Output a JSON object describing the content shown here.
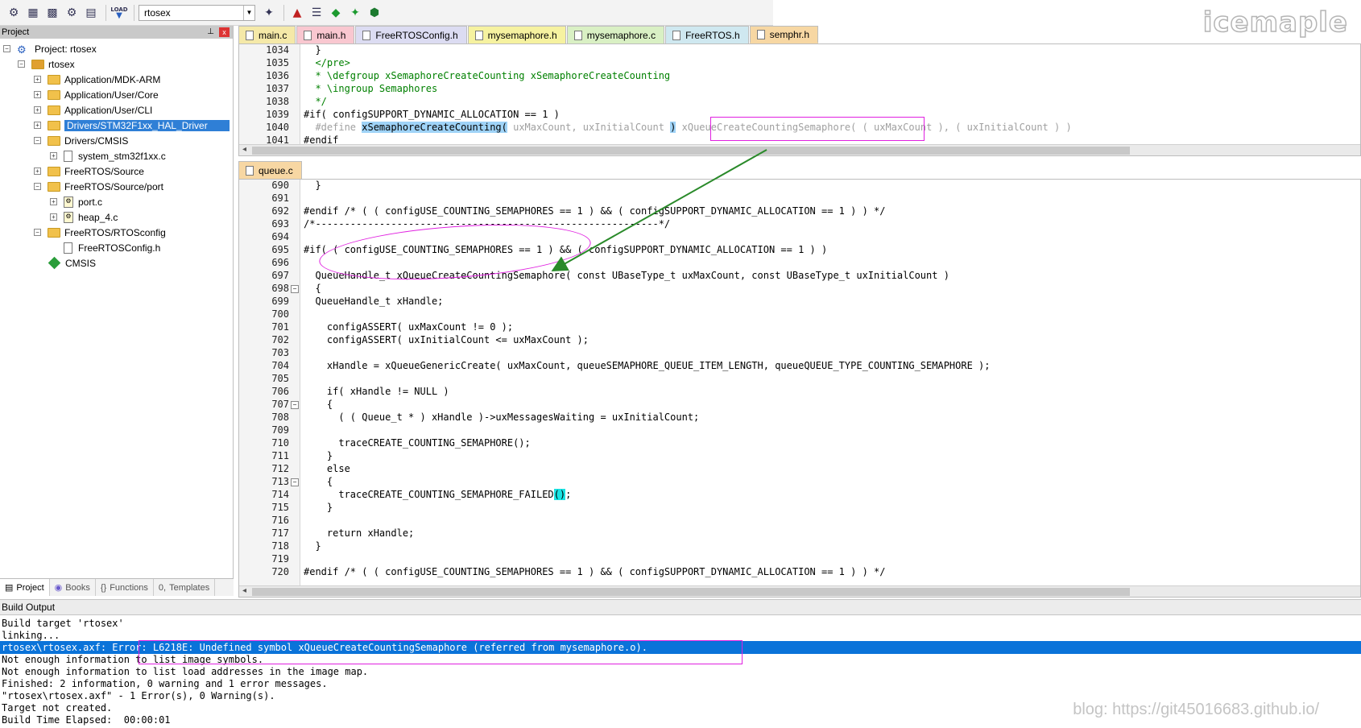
{
  "toolbar": {
    "target_value": "rtosex",
    "load_label": "LOAD",
    "icons": [
      "translate-icon",
      "build-icon",
      "rebuild-icon",
      "batch-build-icon",
      "stop-build-icon",
      "download-icon",
      "target-options-icon",
      "manage-components-icon",
      "manage-books-icon",
      "pack-installer-icon",
      "run-environment-icon",
      "software-packs-icon"
    ]
  },
  "watermark_top": "icemaple",
  "project": {
    "title": "Project",
    "pin": "⊥",
    "close": "x",
    "root": "Project: rtosex",
    "target": "rtosex",
    "groups": [
      {
        "label": "Application/MDK-ARM",
        "expander": "+"
      },
      {
        "label": "Application/User/Core",
        "expander": "+"
      },
      {
        "label": "Application/User/CLI",
        "expander": "+"
      },
      {
        "label": "Drivers/STM32F1xx_HAL_Driver",
        "expander": "+"
      },
      {
        "label": "Drivers/CMSIS",
        "expander": "−"
      },
      {
        "label": "system_stm32f1xx.c",
        "expander": "+"
      },
      {
        "label": "FreeRTOS/Source",
        "expander": "+"
      },
      {
        "label": "FreeRTOS/Source/port",
        "expander": "−"
      },
      {
        "label": "port.c",
        "expander": "+"
      },
      {
        "label": "heap_4.c",
        "expander": "+"
      },
      {
        "label": "FreeRTOS/RTOSconfig",
        "expander": "−"
      },
      {
        "label": "FreeRTOSConfig.h",
        "expander": ""
      },
      {
        "label": "CMSIS",
        "expander": ""
      }
    ],
    "tabs": [
      "Project",
      "Books",
      "Functions",
      "Templates"
    ]
  },
  "file_tabs": [
    {
      "label": "main.c",
      "color": "#f5e9a8"
    },
    {
      "label": "main.h",
      "color": "#f9c7d0"
    },
    {
      "label": "FreeRTOSConfig.h",
      "color": "#dcdcf2"
    },
    {
      "label": "mysemaphore.h",
      "color": "#f6f2a0"
    },
    {
      "label": "mysemaphore.c",
      "color": "#d9f0c4"
    },
    {
      "label": "FreeRTOS.h",
      "color": "#cfe8f0"
    },
    {
      "label": "semphr.h",
      "color": "#f7d7a3"
    }
  ],
  "top_editor": {
    "lines": [
      {
        "n": "1034",
        "t": "  }"
      },
      {
        "n": "1035",
        "t": "  </pre>"
      },
      {
        "n": "1036",
        "t": "  * \\defgroup xSemaphoreCreateCounting xSemaphoreCreateCounting"
      },
      {
        "n": "1037",
        "t": "  * \\ingroup Semaphores"
      },
      {
        "n": "1038",
        "t": "  */"
      },
      {
        "n": "1039",
        "t": "#if( configSUPPORT_DYNAMIC_ALLOCATION == 1 )"
      },
      {
        "n": "1040",
        "pre": "  #define ",
        "sel": "xSemaphoreCreateCounting(",
        "mid": " uxMaxCount, uxInitialCount ",
        "sel2": ")",
        "post": " xQueueCreateCountingSemaphore( ( uxMaxCount ), ( uxInitialCount ) )"
      },
      {
        "n": "1041",
        "t": "#endif"
      }
    ]
  },
  "queue_tab": "queue.c",
  "bottom_editor": {
    "lines": [
      {
        "n": "690",
        "t": "  }",
        "c": "gray"
      },
      {
        "n": "691",
        "t": "",
        "c": "gray"
      },
      {
        "n": "692",
        "t": "#endif /* ( ( configUSE_COUNTING_SEMAPHORES == 1 ) && ( configSUPPORT_DYNAMIC_ALLOCATION == 1 ) ) */",
        "c": "green"
      },
      {
        "n": "693",
        "t": "/*-----------------------------------------------------------*/",
        "c": "green"
      },
      {
        "n": "694",
        "t": "",
        "c": "gray"
      },
      {
        "n": "695",
        "t": "#if( ( configUSE_COUNTING_SEMAPHORES == 1 ) && ( configSUPPORT_DYNAMIC_ALLOCATION == 1 ) )",
        "c": "dark"
      },
      {
        "n": "696",
        "t": "",
        "c": "gray"
      },
      {
        "n": "697",
        "t": "  QueueHandle_t xQueueCreateCountingSemaphore( const UBaseType_t uxMaxCount, const UBaseType_t uxInitialCount )",
        "c": "gray"
      },
      {
        "n": "698",
        "t": "  {",
        "c": "gray",
        "fold": "−"
      },
      {
        "n": "699",
        "t": "  QueueHandle_t xHandle;",
        "c": "gray"
      },
      {
        "n": "700",
        "t": "",
        "c": "gray"
      },
      {
        "n": "701",
        "t": "    configASSERT( uxMaxCount != 0 );",
        "c": "gray"
      },
      {
        "n": "702",
        "t": "    configASSERT( uxInitialCount <= uxMaxCount );",
        "c": "gray"
      },
      {
        "n": "703",
        "t": "",
        "c": "gray"
      },
      {
        "n": "704",
        "t": "    xHandle = xQueueGenericCreate( uxMaxCount, queueSEMAPHORE_QUEUE_ITEM_LENGTH, queueQUEUE_TYPE_COUNTING_SEMAPHORE );",
        "c": "gray"
      },
      {
        "n": "705",
        "t": "",
        "c": "gray"
      },
      {
        "n": "706",
        "t": "    if( xHandle != NULL )",
        "c": "gray"
      },
      {
        "n": "707",
        "t": "    {",
        "c": "gray",
        "fold": "−"
      },
      {
        "n": "708",
        "t": "      ( ( Queue_t * ) xHandle )->uxMessagesWaiting = uxInitialCount;",
        "c": "gray"
      },
      {
        "n": "709",
        "t": "",
        "c": "gray"
      },
      {
        "n": "710",
        "t": "      traceCREATE_COUNTING_SEMAPHORE();",
        "c": "gray"
      },
      {
        "n": "711",
        "t": "    }",
        "c": "gray"
      },
      {
        "n": "712",
        "t": "    else",
        "c": "gray"
      },
      {
        "n": "713",
        "t": "    {",
        "c": "gray",
        "fold": "−"
      },
      {
        "n": "714",
        "t": "      traceCREATE_COUNTING_SEMAPHORE_FAILED",
        "cyan": "()",
        "after": ";",
        "c": "gray"
      },
      {
        "n": "715",
        "t": "    }",
        "c": "gray"
      },
      {
        "n": "716",
        "t": "",
        "c": "gray"
      },
      {
        "n": "717",
        "t": "    return xHandle;",
        "c": "gray"
      },
      {
        "n": "718",
        "t": "  }",
        "c": "gray"
      },
      {
        "n": "719",
        "t": "",
        "c": "gray"
      },
      {
        "n": "720",
        "t": "#endif /* ( ( configUSE_COUNTING_SEMAPHORES == 1 ) && ( configSUPPORT_DYNAMIC_ALLOCATION == 1 ) ) */",
        "c": "green"
      }
    ]
  },
  "build": {
    "title": "Build Output",
    "lines": [
      {
        "t": "Build target 'rtosex'"
      },
      {
        "t": "linking..."
      },
      {
        "t": "rtosex\\rtosex.axf: Error: L6218E: Undefined symbol xQueueCreateCountingSemaphore (referred from mysemaphore.o).",
        "err": true
      },
      {
        "t": "Not enough information to list image symbols."
      },
      {
        "t": "Not enough information to list load addresses in the image map."
      },
      {
        "t": "Finished: 2 information, 0 warning and 1 error messages."
      },
      {
        "t": "\"rtosex\\rtosex.axf\" - 1 Error(s), 0 Warning(s)."
      },
      {
        "t": "Target not created."
      },
      {
        "t": "Build Time Elapsed:  00:00:01"
      }
    ]
  },
  "watermark_bottom": "blog: https://git45016683.github.io/",
  "colors": {
    "annotation": "#e020e0",
    "arrow": "#2a8a2a",
    "error_row": "#0a73d9",
    "selection": "#2f7fd6"
  }
}
